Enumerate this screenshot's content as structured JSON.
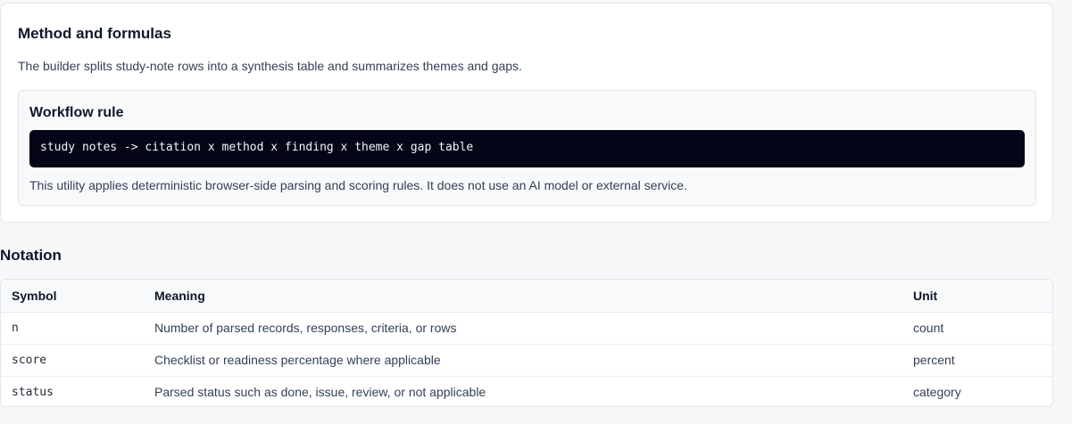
{
  "method": {
    "title": "Method and formulas",
    "description": "The builder splits study-note rows into a synthesis table and summarizes themes and gaps.",
    "rule": {
      "title": "Workflow rule",
      "code": "study notes -> citation x method x finding x theme x gap table",
      "note": "This utility applies deterministic browser-side parsing and scoring rules. It does not use an AI model or external service."
    }
  },
  "notation": {
    "title": "Notation",
    "headers": [
      "Symbol",
      "Meaning",
      "Unit"
    ],
    "rows": [
      {
        "symbol": "n",
        "meaning": "Number of parsed records, responses, criteria, or rows",
        "unit": "count"
      },
      {
        "symbol": "score",
        "meaning": "Checklist or readiness percentage where applicable",
        "unit": "percent"
      },
      {
        "symbol": "status",
        "meaning": "Parsed status such as done, issue, review, or not applicable",
        "unit": "category"
      }
    ]
  }
}
